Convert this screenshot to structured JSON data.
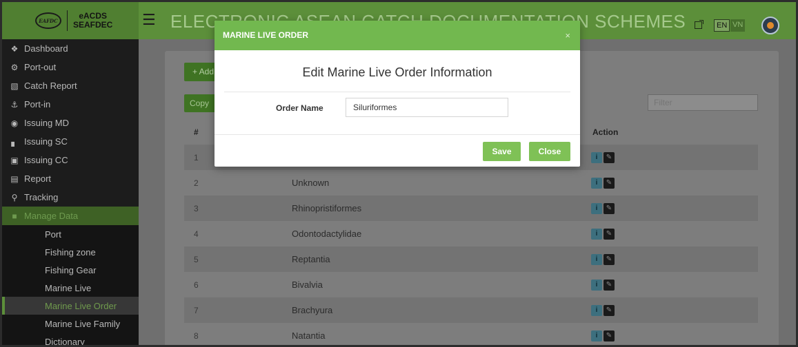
{
  "brand": {
    "logo_text": "EAFDC",
    "line1": "eACDS",
    "line2": "SEAFDEC"
  },
  "header": {
    "title": "ELECTRONIC ASEAN CATCH DOCUMENTATION SCHEMES",
    "lang_en": "EN",
    "lang_vn": "VN"
  },
  "sidebar": {
    "items": [
      {
        "label": "Dashboard",
        "icon": "home-icon"
      },
      {
        "label": "Port-out",
        "icon": "gear-icon"
      },
      {
        "label": "Catch Report",
        "icon": "file-icon"
      },
      {
        "label": "Port-in",
        "icon": "anchor-icon"
      },
      {
        "label": "Issuing MD",
        "icon": "disc-icon"
      },
      {
        "label": "Issuing SC",
        "icon": "factory-icon"
      },
      {
        "label": "Issuing CC",
        "icon": "cc-icon"
      },
      {
        "label": "Report",
        "icon": "chart-icon"
      },
      {
        "label": "Tracking",
        "icon": "map-marker-icon"
      },
      {
        "label": "Manage Data",
        "icon": "folder-icon"
      }
    ],
    "sub_items": [
      {
        "label": "Port"
      },
      {
        "label": "Fishing zone"
      },
      {
        "label": "Fishing Gear"
      },
      {
        "label": "Marine Live"
      },
      {
        "label": "Marine Live Order"
      },
      {
        "label": "Marine Live Family"
      },
      {
        "label": "Dictionary"
      }
    ]
  },
  "main": {
    "add_label": "+ Add",
    "copy_label": "Copy",
    "filter_placeholder": "Filter",
    "col_num": "#",
    "col_action": "Action",
    "rows": [
      {
        "num": "1",
        "name": ""
      },
      {
        "num": "2",
        "name": "Unknown"
      },
      {
        "num": "3",
        "name": "Rhinopristiformes"
      },
      {
        "num": "4",
        "name": "Odontodactylidae"
      },
      {
        "num": "5",
        "name": "Reptantia"
      },
      {
        "num": "6",
        "name": "Bivalvia"
      },
      {
        "num": "7",
        "name": "Brachyura"
      },
      {
        "num": "8",
        "name": "Natantia"
      }
    ]
  },
  "modal": {
    "header": "MARINE LIVE ORDER",
    "close_x": "×",
    "title": "Edit Marine Live Order Information",
    "field_label": "Order Name",
    "field_value": "Siluriformes",
    "save_label": "Save",
    "close_label": "Close"
  },
  "colors": {
    "brand_green": "#72b84f",
    "header_green": "#5c8f3a",
    "sidebar_bg": "#1c1c1c",
    "info_teal": "#17a2b8"
  }
}
